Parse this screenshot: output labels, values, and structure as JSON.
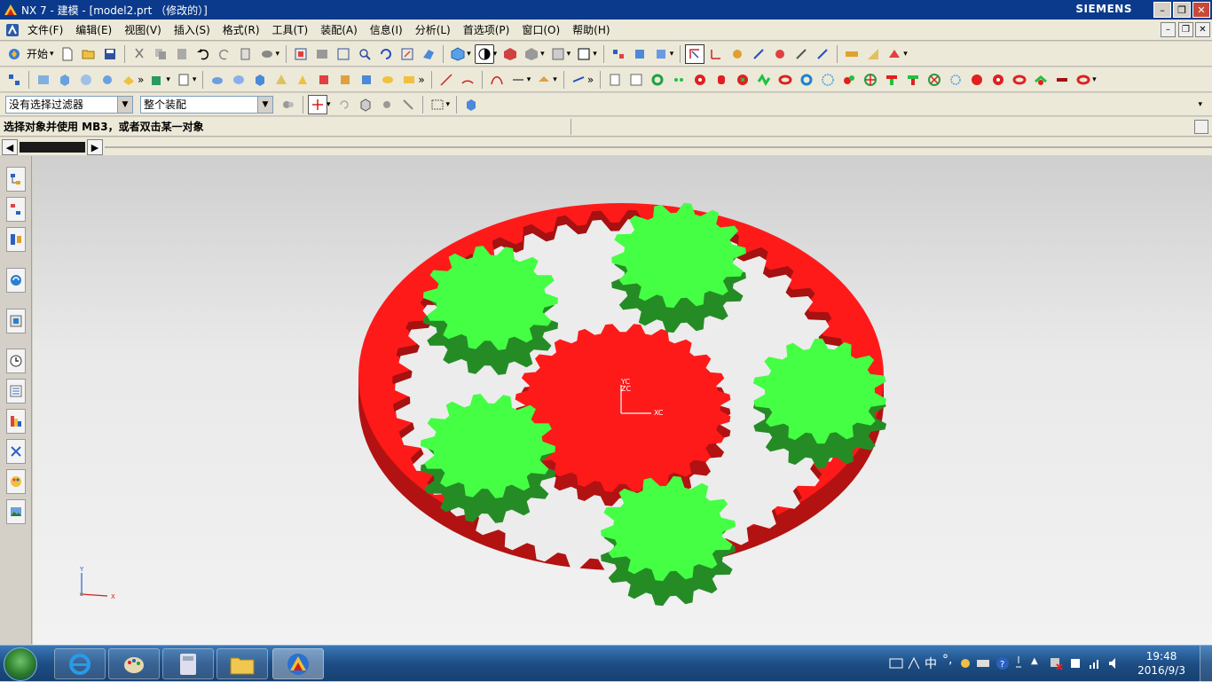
{
  "window": {
    "title": "NX 7 - 建模 - [model2.prt （修改的）]",
    "brand": "SIEMENS"
  },
  "menu": {
    "items": [
      "文件(F)",
      "编辑(E)",
      "视图(V)",
      "插入(S)",
      "格式(R)",
      "工具(T)",
      "装配(A)",
      "信息(I)",
      "分析(L)",
      "首选项(P)",
      "窗口(O)",
      "帮助(H)"
    ]
  },
  "toolbar": {
    "start_label": "开始"
  },
  "filter": {
    "selection_filter": "没有选择过滤器",
    "scope": "整个装配"
  },
  "status": {
    "prompt": "选择对象并使用 MB3，或者双击某一对象"
  },
  "viewport": {
    "csys_label_yc": "YC",
    "csys_label_zc": "ZC",
    "csys_label_xc": "XC",
    "triad_x": "X",
    "triad_y": "Y",
    "ring_color": "#ff1a1a",
    "planet_color": "#44ff44",
    "sun_color": "#ff1a1a"
  },
  "taskbar": {
    "ime": "中",
    "time": "19:48",
    "date": "2016/9/3"
  }
}
